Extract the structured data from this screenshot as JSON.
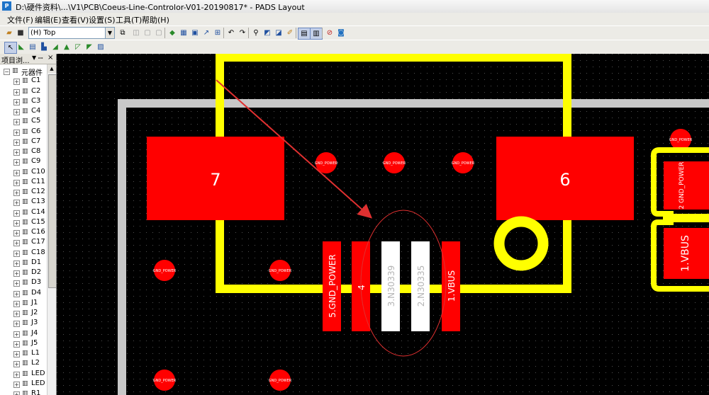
{
  "window": {
    "title": "D:\\硬件资料\\...\\V1\\PCB\\Coeus-Line-Controlor-V01-20190817* - PADS Layout",
    "app_icon": "P"
  },
  "menu": [
    "文件(F)",
    "编辑(E)",
    "查看(V)",
    "设置(S)",
    "工具(T)",
    "帮助(H)"
  ],
  "toolbar": {
    "layer_select": "(H) Top"
  },
  "panel": {
    "title": "项目浏...",
    "pin": "ꟷ",
    "close": "×",
    "root": "元器件",
    "items": [
      "C1",
      "C2",
      "C3",
      "C4",
      "C5",
      "C6",
      "C7",
      "C8",
      "C9",
      "C10",
      "C11",
      "C12",
      "C13",
      "C14",
      "C15",
      "C16",
      "C17",
      "C18",
      "D1",
      "D2",
      "D3",
      "D4",
      "J1",
      "J2",
      "J3",
      "J4",
      "J5",
      "L1",
      "L2",
      "LED",
      "LED",
      "R1"
    ]
  },
  "pcb": {
    "pads": [
      {
        "label": "7"
      },
      {
        "label": "6"
      },
      {
        "label": "5.GND_POWER"
      },
      {
        "label": "4"
      },
      {
        "label": "3.N30339"
      },
      {
        "label": "2.N30335"
      },
      {
        "label": "1.VBUS"
      }
    ],
    "vias": [
      "GND_POWER",
      "GND_POWER",
      "GND_POWER",
      "GND_POWER",
      "GND_POWER",
      "GND_POWER",
      "GND_POWER",
      "GND_POWER",
      "GND_POWER"
    ],
    "side_component": {
      "top_pad": "2\nGND_POWER",
      "bottom_pad": "1.VBUS"
    }
  },
  "colors": {
    "copper": "#ff0000",
    "silkscreen": "#ffff00",
    "board_outline": "#c8c8c8",
    "highlight": "#ffffff",
    "annotation": "#e03030"
  }
}
